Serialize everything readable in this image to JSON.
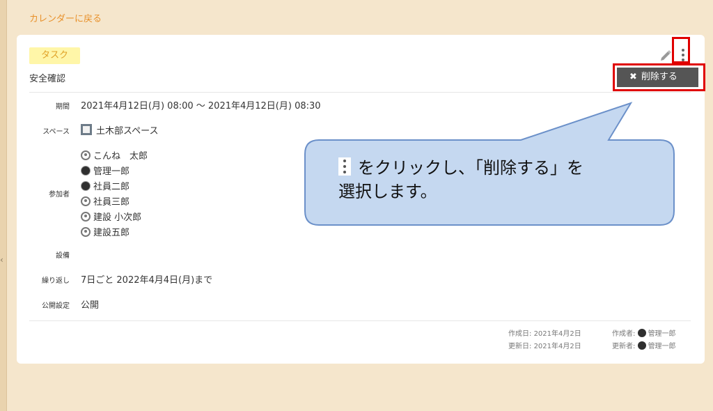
{
  "nav": {
    "back_label": "カレンダーに戻る"
  },
  "event": {
    "type_badge": "タスク",
    "title": "安全確認",
    "actions": {
      "delete_label": "削除する",
      "delete_glyph": "✖"
    },
    "fields": [
      {
        "label": "期間",
        "value": "2021年4月12日(月) 08:00 ～ 2021年4月12日(月) 08:30"
      },
      {
        "label": "スペース",
        "value": "土木部スペース"
      },
      {
        "label": "参加者",
        "participants": [
          {
            "name": "こんね　太郎",
            "avatar": "default"
          },
          {
            "name": "管理一郎",
            "avatar": "photo"
          },
          {
            "name": "社員二郎",
            "avatar": "photo"
          },
          {
            "name": "社員三郎",
            "avatar": "default"
          },
          {
            "name": "建設 小次郎",
            "avatar": "default"
          },
          {
            "name": "建設五郎",
            "avatar": "default"
          }
        ]
      },
      {
        "label": "設備",
        "value": ""
      },
      {
        "label": "繰り返し",
        "value": "7日ごと 2022年4月4日(月)まで"
      },
      {
        "label": "公開設定",
        "value": "公開"
      }
    ],
    "meta": {
      "created_label": "作成日:",
      "created_date": "2021年4月2日",
      "creator_label": "作成者:",
      "creator_name": "管理一郎",
      "updated_label": "更新日:",
      "updated_date": "2021年4月2日",
      "updater_label": "更新者:",
      "updater_name": "管理一郎"
    }
  },
  "callout": {
    "line1": "をクリックし、「削除する」を",
    "line2": "選択します。"
  },
  "colors": {
    "page_bg": "#f5e6cc",
    "accent": "#e8912b",
    "badge_bg": "#fff6a8",
    "highlight": "#e00000",
    "callout_fill": "#c5d8f0",
    "callout_stroke": "#6b90c9",
    "delete_bg": "#555555"
  }
}
